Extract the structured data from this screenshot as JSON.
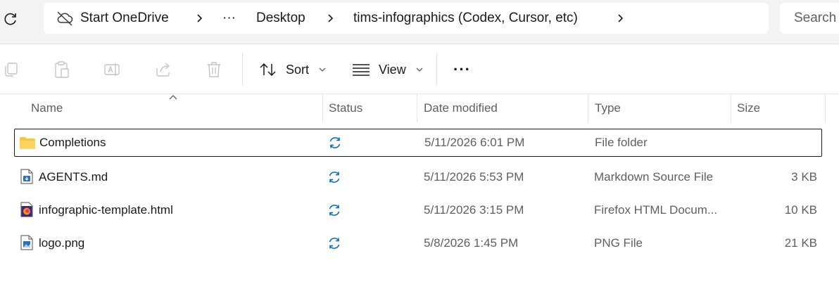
{
  "address": {
    "crumbs": [
      "Start OneDrive",
      "···",
      "Desktop",
      "tims-infographics (Codex, Cursor, etc)"
    ],
    "search_placeholder": "Search"
  },
  "toolbar": {
    "sort_label": "Sort",
    "view_label": "View",
    "more_label": "···"
  },
  "columns": {
    "name": "Name",
    "status": "Status",
    "date_modified": "Date modified",
    "type": "Type",
    "size": "Size"
  },
  "files": [
    {
      "name": "Completions",
      "date": "5/11/2026 6:01 PM",
      "type": "File folder",
      "size": "",
      "icon": "folder-icon"
    },
    {
      "name": "AGENTS.md",
      "date": "5/11/2026 5:53 PM",
      "type": "Markdown Source File",
      "size": "3 KB",
      "icon": "markdown-file-icon"
    },
    {
      "name": "infographic-template.html",
      "date": "5/11/2026 3:15 PM",
      "type": "Firefox HTML Docum...",
      "size": "10 KB",
      "icon": "firefox-html-icon"
    },
    {
      "name": "logo.png",
      "date": "5/8/2026 1:45 PM",
      "type": "PNG File",
      "size": "21 KB",
      "icon": "png-file-icon"
    }
  ],
  "colors": {
    "accent": "#0067c0",
    "folder": "#f4c542",
    "selection_border": "#1a1a1a"
  }
}
